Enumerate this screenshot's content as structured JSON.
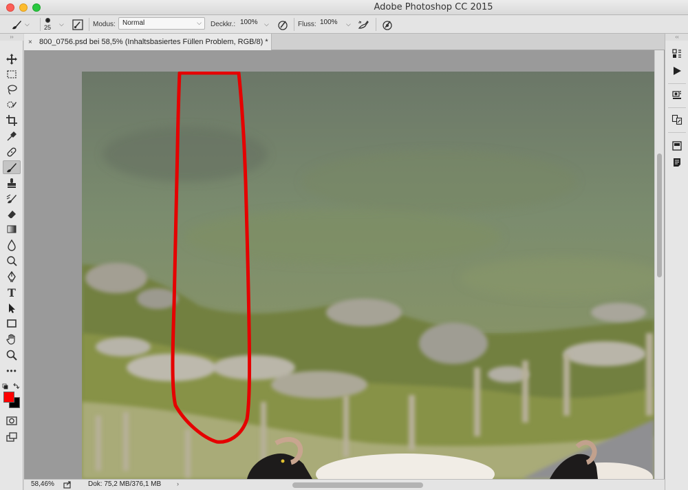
{
  "window": {
    "title": "Adobe Photoshop CC 2015"
  },
  "options_bar": {
    "brush_size": "25",
    "mode_label": "Modus:",
    "mode_value": "Normal",
    "opacity_label": "Deckkr.:",
    "opacity_value": "100%",
    "flow_label": "Fluss:",
    "flow_value": "100%"
  },
  "document": {
    "tab_title": "800_0756.psd bei 58,5% (Inhaltsbasiertes Füllen Problem, RGB/8) *",
    "tab_close": "×"
  },
  "status_bar": {
    "zoom": "58,46%",
    "doc_info": "Dok: 75,2 MB/376,1 MB",
    "arrow": "›"
  },
  "toolbar": {
    "collapse": "››",
    "tools": [
      "move-tool",
      "marquee-tool",
      "lasso-tool",
      "quick-selection-tool",
      "crop-tool",
      "eyedropper-tool",
      "healing-brush-tool",
      "brush-tool",
      "clone-stamp-tool",
      "history-brush-tool",
      "eraser-tool",
      "gradient-tool",
      "blur-tool",
      "dodge-tool",
      "pen-tool",
      "type-tool",
      "path-selection-tool",
      "rectangle-tool",
      "hand-tool",
      "zoom-tool",
      "more-tools"
    ],
    "type_glyph": "T",
    "more_glyph": "•••",
    "active_tool": "brush-tool",
    "foreground_color": "#ff0000",
    "background_color": "#000000"
  },
  "dock": {
    "collapse": "‹‹"
  },
  "colors": {
    "selection_stroke": "#e50000"
  }
}
